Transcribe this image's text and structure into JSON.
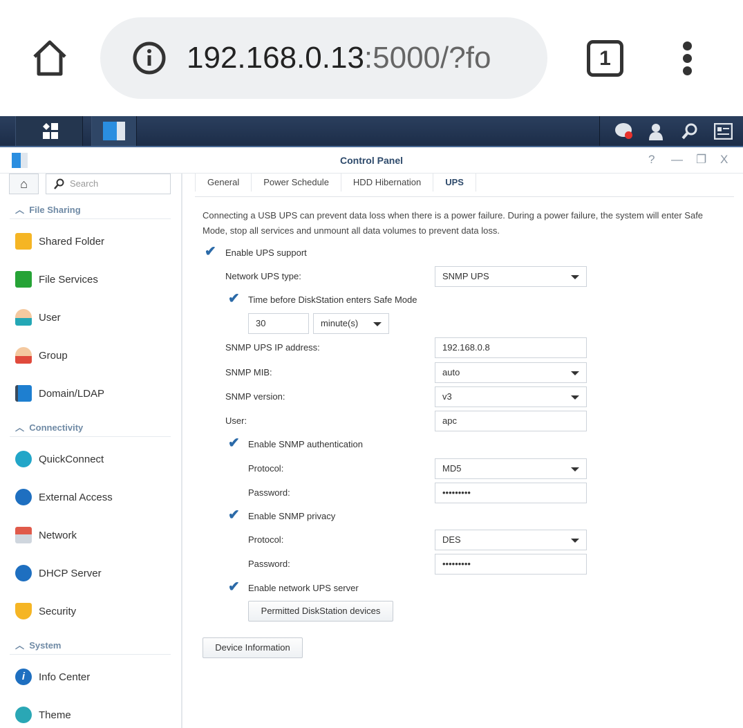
{
  "browser": {
    "url_host": "192.168.0.13",
    "url_rest": ":5000/?fo",
    "tab_count": "1"
  },
  "window": {
    "title": "Control Panel",
    "help": "?",
    "minimize": "—",
    "restore": "❐",
    "close": "X"
  },
  "sidebar": {
    "search_placeholder": "Search",
    "sections": [
      {
        "label": "File Sharing",
        "items": [
          "Shared Folder",
          "File Services",
          "User",
          "Group",
          "Domain/LDAP"
        ]
      },
      {
        "label": "Connectivity",
        "items": [
          "QuickConnect",
          "External Access",
          "Network",
          "DHCP Server",
          "Security"
        ]
      },
      {
        "label": "System",
        "items": [
          "Info Center",
          "Theme"
        ]
      }
    ]
  },
  "tabs": [
    "General",
    "Power Schedule",
    "HDD Hibernation",
    "UPS"
  ],
  "ups": {
    "description1": "Connecting a USB UPS can prevent data loss when there is a power failure. During a power failure, the system will enter Safe",
    "description2": "Mode, stop all services and unmount all data volumes to prevent data loss.",
    "enable_ups": "Enable UPS support",
    "network_type_label": "Network UPS type:",
    "network_type": "SNMP UPS",
    "safe_mode_label": "Time before DiskStation enters Safe Mode",
    "time_value": "30",
    "time_unit": "minute(s)",
    "ip_label": "SNMP UPS IP address:",
    "ip": "192.168.0.8",
    "mib_label": "SNMP MIB:",
    "mib": "auto",
    "version_label": "SNMP version:",
    "version": "v3",
    "user_label": "User:",
    "user": "apc",
    "auth_label": "Enable SNMP authentication",
    "auth_protocol_label": "Protocol:",
    "auth_protocol": "MD5",
    "auth_password_label": "Password:",
    "auth_password": "•••••••••",
    "privacy_label": "Enable SNMP privacy",
    "priv_protocol_label": "Protocol:",
    "priv_protocol": "DES",
    "priv_password_label": "Password:",
    "priv_password": "•••••••••",
    "server_label": "Enable network UPS server",
    "permitted_button": "Permitted DiskStation devices",
    "device_info_button": "Device Information"
  }
}
